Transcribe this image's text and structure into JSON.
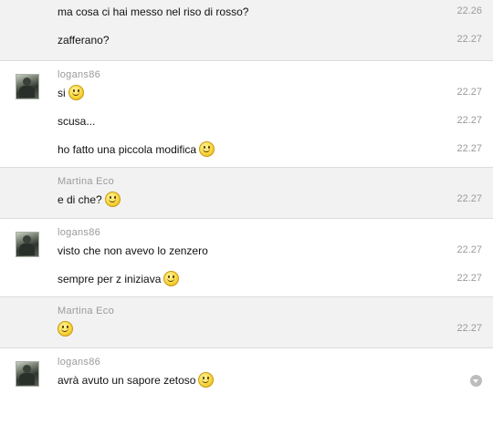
{
  "groups": [
    {
      "sender": "",
      "messages": [
        {
          "text": "ma cosa ci hai messo nel riso di rosso?",
          "time": "22.26"
        },
        {
          "text": "zafferano?",
          "time": "22.27"
        }
      ]
    },
    {
      "sender": "logans86",
      "avatar": "user-avatar",
      "messages": [
        {
          "text": "si",
          "emoticon": "smiley-icon",
          "time": "22.27"
        },
        {
          "text": "scusa...",
          "time": "22.27"
        },
        {
          "text": "ho fatto una piccola modifica",
          "emoticon": "smiley-icon",
          "time": "22.27"
        }
      ]
    },
    {
      "sender": "Martina Eco",
      "messages": [
        {
          "text": "e di che?",
          "emoticon": "smiley-icon",
          "time": "22.27"
        }
      ]
    },
    {
      "sender": "logans86",
      "avatar": "user-avatar",
      "messages": [
        {
          "text": "visto che non avevo lo zenzero",
          "time": "22.27"
        },
        {
          "text": "sempre per z iniziava",
          "emoticon": "smiley-icon",
          "time": "22.27"
        }
      ]
    },
    {
      "sender": "Martina Eco",
      "messages": [
        {
          "text": "",
          "emoticon": "smiley-icon",
          "time": "22.27"
        }
      ]
    },
    {
      "sender": "logans86",
      "avatar": "user-avatar",
      "messages": [
        {
          "text": "avrà avuto un sapore zetoso",
          "emoticon": "smiley-icon",
          "time": "",
          "action_icon": "chevron-down-icon"
        }
      ]
    }
  ]
}
